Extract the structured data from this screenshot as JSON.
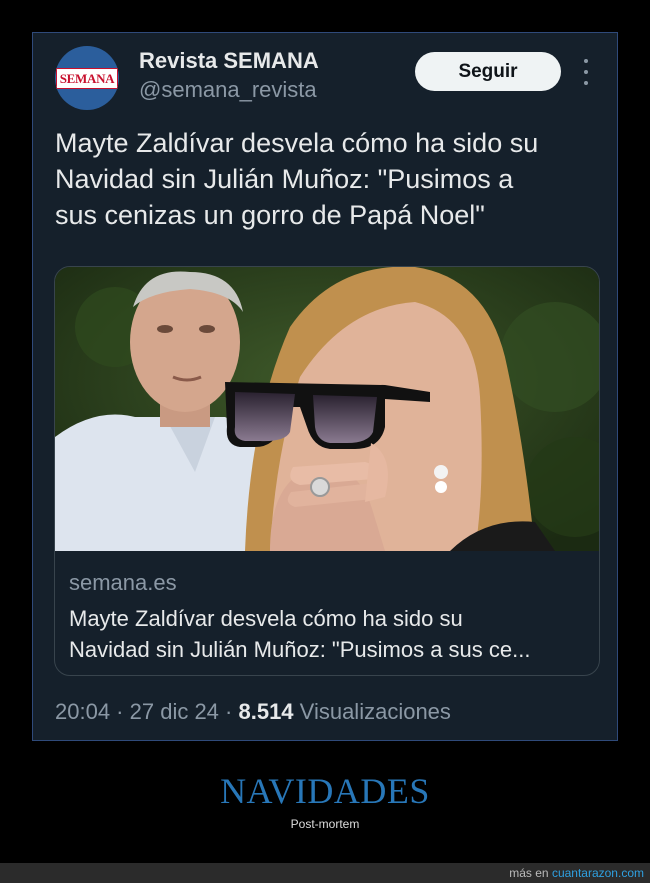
{
  "tweet": {
    "account": {
      "avatar_text": "SEMANA",
      "display_name": "Revista SEMANA",
      "handle": "@semana_revista"
    },
    "follow_label": "Seguir",
    "text_lines": [
      "Mayte Zaldívar desvela cómo ha sido su",
      "Navidad sin Julián Muñoz: \"Pusimos a",
      "sus cenizas un gorro de Papá Noel\""
    ],
    "link_card": {
      "domain": "semana.es",
      "title_lines": [
        "Mayte Zaldívar desvela cómo ha sido su",
        "Navidad sin Julián Muñoz: \"Pusimos a sus ce..."
      ]
    },
    "time": "20:04",
    "date": "27 dic 24",
    "separator": " · ",
    "views_count": "8.514",
    "views_label": "Visualizaciones"
  },
  "caption": {
    "title": "NAVIDADES",
    "subtitle": "Post-mortem"
  },
  "footer": {
    "prefix": "más en",
    "link": "cuantarazon.com"
  },
  "colors": {
    "card_bg": "#15202b",
    "accent_blue": "#2877b8",
    "text_primary": "#e7e9ea",
    "text_secondary": "#8b98a5"
  },
  "icons": [
    "more-options-icon"
  ]
}
